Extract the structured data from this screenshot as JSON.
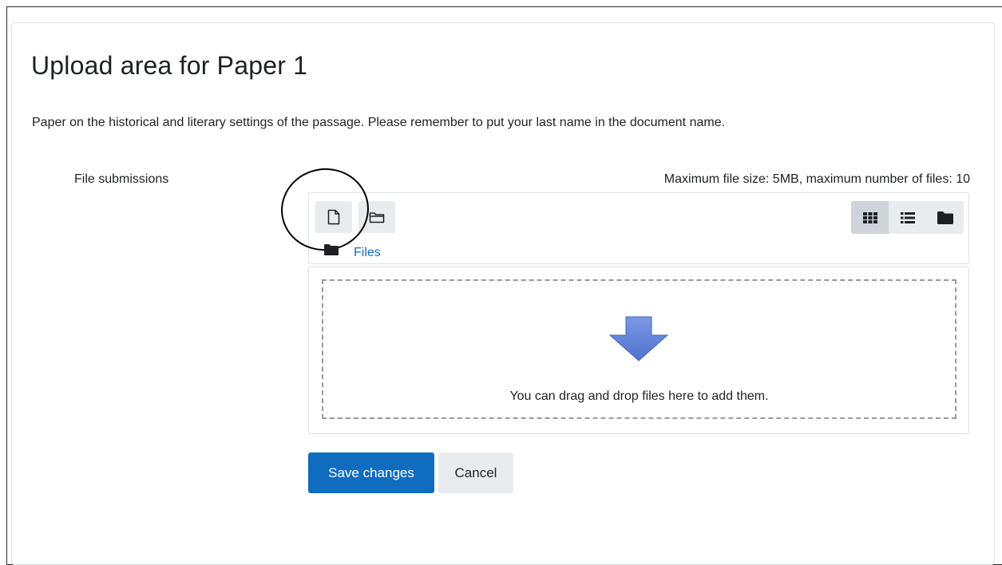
{
  "page": {
    "title": "Upload area for Paper 1",
    "intro": "Paper on the historical and literary settings of the passage. Please remember to put your last name in the document name."
  },
  "form": {
    "field_label": "File submissions",
    "limits_text": "Maximum file size: 5MB, maximum number of files: 10"
  },
  "filepicker": {
    "toolbar": {
      "add_file_icon": "file-icon",
      "create_folder_icon": "folder-outline-icon"
    },
    "view_modes": [
      {
        "icon": "grid-icon",
        "active": true
      },
      {
        "icon": "list-icon",
        "active": false
      },
      {
        "icon": "folder-tree-icon",
        "active": false
      }
    ],
    "path": {
      "folder_icon": "folder-icon",
      "label": "Files"
    },
    "dropzone": {
      "arrow_icon": "download-arrow-icon",
      "text": "You can drag and drop files here to add them."
    }
  },
  "actions": {
    "save_label": "Save changes",
    "cancel_label": "Cancel"
  },
  "colors": {
    "primary": "#0f6cbf",
    "secondary_bg": "#e9ecef",
    "link": "#0f6cbf",
    "arrow": "#5b7fd6"
  }
}
